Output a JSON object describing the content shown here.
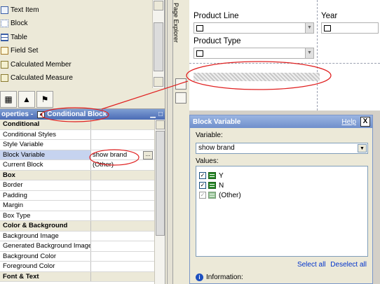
{
  "toolbox": {
    "items": [
      {
        "label": "Text Item",
        "icon": "text-item-icon"
      },
      {
        "label": "Block",
        "icon": "block-icon"
      },
      {
        "label": "Table",
        "icon": "table-icon"
      },
      {
        "label": "Field Set",
        "icon": "field-set-icon"
      },
      {
        "label": "Calculated Member",
        "icon": "calculated-member-icon"
      },
      {
        "label": "Calculated Measure",
        "icon": "calculated-measure-icon"
      }
    ]
  },
  "tabs": [
    {
      "icon": "insertable-objects-icon"
    },
    {
      "icon": "data-items-icon"
    },
    {
      "icon": "toolbox-icon"
    }
  ],
  "properties": {
    "header_prefix": "operties",
    "header_sep": "-",
    "header_title": "Conditional Block",
    "rows": [
      {
        "name": "Conditional",
        "value": "",
        "section": true
      },
      {
        "name": "Conditional Styles",
        "value": ""
      },
      {
        "name": "Style Variable",
        "value": ""
      },
      {
        "name": "Block Variable",
        "value": "show brand",
        "selected": true,
        "has_button": true
      },
      {
        "name": "Current Block",
        "value": "(Other)"
      },
      {
        "name": "Box",
        "value": "",
        "section": true
      },
      {
        "name": "Border",
        "value": ""
      },
      {
        "name": "Padding",
        "value": ""
      },
      {
        "name": "Margin",
        "value": ""
      },
      {
        "name": "Box Type",
        "value": ""
      },
      {
        "name": "Color & Background",
        "value": "",
        "section": true
      },
      {
        "name": "Background Image",
        "value": ""
      },
      {
        "name": "Generated Background Image",
        "value": ""
      },
      {
        "name": "Background Color",
        "value": ""
      },
      {
        "name": "Foreground Color",
        "value": ""
      },
      {
        "name": "Font & Text",
        "value": "",
        "section": true
      }
    ],
    "ellipsis_label": "..."
  },
  "page_explorer": {
    "label": "Page Explorer"
  },
  "canvas": {
    "product_line_label": "Product Line",
    "year_label": "Year",
    "product_type_label": "Product Type"
  },
  "dialog": {
    "title": "Block Variable",
    "help_label": "Help",
    "close_label": "X",
    "variable_label": "Variable:",
    "variable_value": "show brand",
    "values_label": "Values:",
    "values": [
      {
        "label": "Y",
        "checked": true,
        "disabled": false
      },
      {
        "label": "N",
        "checked": true,
        "disabled": false
      },
      {
        "label": "(Other)",
        "checked": true,
        "disabled": true
      }
    ],
    "select_all_label": "Select all",
    "deselect_all_label": "Deselect all",
    "information_label": "Information:"
  },
  "colors": {
    "annotation": "#e02020",
    "title_bar": "#4a6bb5",
    "link": "#0033cc"
  }
}
